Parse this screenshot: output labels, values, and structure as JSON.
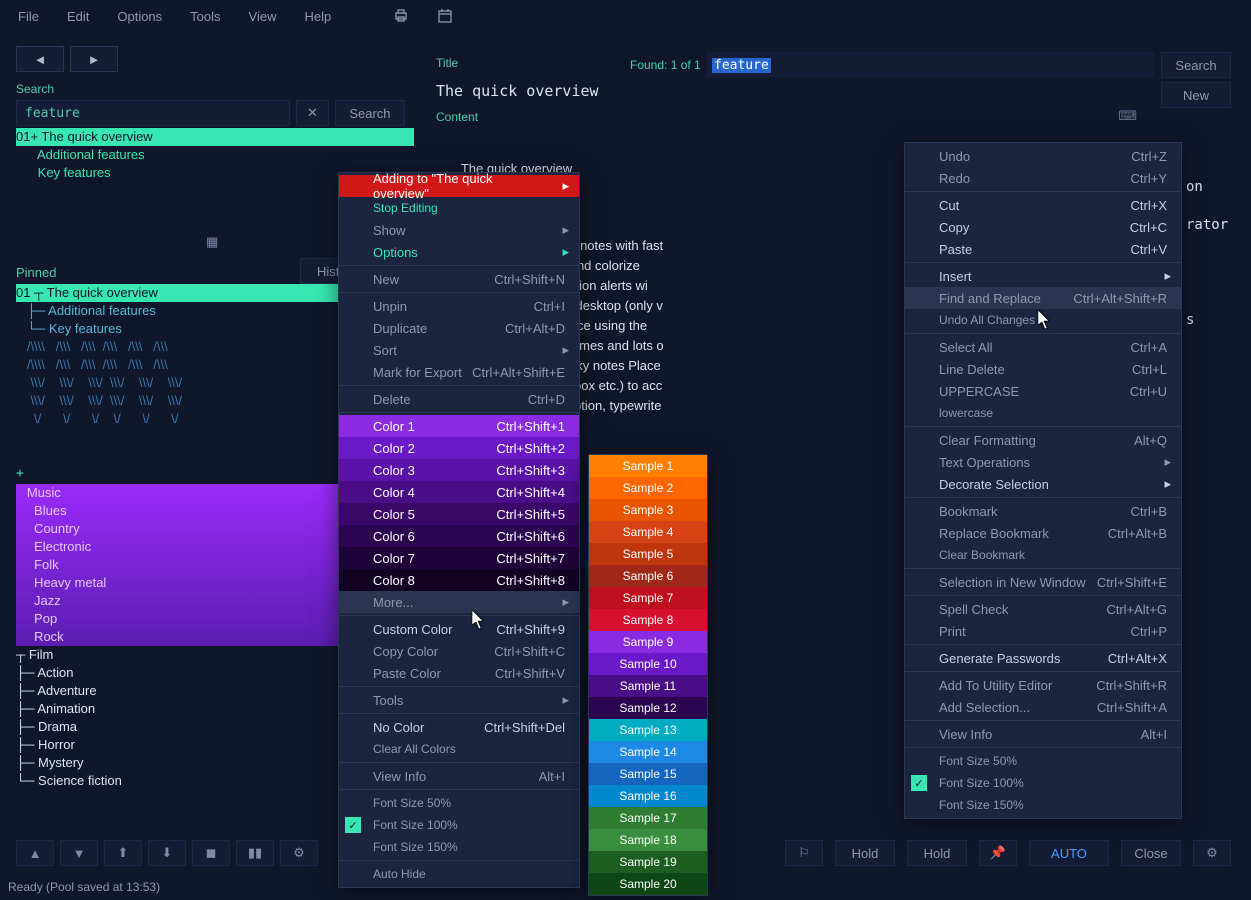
{
  "menu": {
    "file": "File",
    "edit": "Edit",
    "options": "Options",
    "tools": "Tools",
    "view": "View",
    "help": "Help"
  },
  "search": {
    "label": "Search",
    "value": "feature",
    "btn": "Search",
    "clear": "✕"
  },
  "tree": {
    "r1": "01+ The quick overview",
    "r2": "      Additional features",
    "r3": "      Key features"
  },
  "pinned": {
    "label": "Pinned",
    "hist": "Hist",
    "r1": "01 ┬ The quick overview",
    "r2": "   ├─ Additional features",
    "r3": "   └─ Key features",
    "a1": "   /\\\\\\\\   /\\\\\\   /\\\\\\  /\\\\\\   /\\\\\\   /\\\\\\",
    "a2": "   /\\\\\\\\   /\\\\\\   /\\\\\\  /\\\\\\   /\\\\\\   /\\\\\\",
    "a3": "    \\\\\\/    \\\\\\/    \\\\\\/  \\\\\\/    \\\\\\/    \\\\\\/",
    "a4": "    \\\\\\/    \\\\\\/    \\\\\\/  \\\\\\/    \\\\\\/    \\\\\\/",
    "a5": "     \\/      \\/      \\/    \\/      \\/      \\/",
    "plus": "+"
  },
  "music": {
    "r1": "   Music",
    "r2": "     Blues",
    "r3": "     Country",
    "r4": "     Electronic",
    "r5": "     Folk",
    "r6": "     Heavy metal",
    "r7": "     Jazz",
    "r8": "     Pop",
    "r9": "     Rock"
  },
  "film": {
    "r1": "┬ Film",
    "r2": "├─ Action",
    "r3": "├─ Adventure",
    "r4": "├─ Animation",
    "r5": "├─ Drama",
    "r6": "├─ Horror",
    "r7": "├─ Mystery",
    "r8": "└─ Science fiction"
  },
  "title": {
    "label": "Title",
    "found": "Found: 1 of 1",
    "hl": "feature",
    "search": "Search",
    "new": "New",
    "text": "The quick overview"
  },
  "contentlbl": "Content",
  "content": {
    "l1": "The quick overview",
    "body_a": "…pository of private notes with fast\n…rioritize, categorize and colorize\n…kup ",
    "body_hl": "feature",
    "body_b": "s Notification alerts wi\n…sticky notes on your desktop (only v\n…multiple entries at once using the\n…rogress bar Color themes and lots o\n…main editors and sticky notes Place\n…der (OneDrive, Dropbox etc.) to acc\n…ator, message encryption, typewrite",
    "tail": "on\n\nrator\n\n\n\n\ns"
  },
  "ctx1": {
    "adding": "Adding to \"The quick overview\"",
    "stop": "Stop Editing",
    "show": "Show",
    "options": "Options",
    "new": "New",
    "new_sc": "Ctrl+Shift+N",
    "unpin": "Unpin",
    "unpin_sc": "Ctrl+I",
    "dup": "Duplicate",
    "dup_sc": "Ctrl+Alt+D",
    "sort": "Sort",
    "mark": "Mark for Export",
    "mark_sc": "Ctrl+Alt+Shift+E",
    "del": "Delete",
    "del_sc": "Ctrl+D",
    "c1": "Color 1",
    "c1s": "Ctrl+Shift+1",
    "c2": "Color 2",
    "c2s": "Ctrl+Shift+2",
    "c3": "Color 3",
    "c3s": "Ctrl+Shift+3",
    "c4": "Color 4",
    "c4s": "Ctrl+Shift+4",
    "c5": "Color 5",
    "c5s": "Ctrl+Shift+5",
    "c6": "Color 6",
    "c6s": "Ctrl+Shift+6",
    "c7": "Color 7",
    "c7s": "Ctrl+Shift+7",
    "c8": "Color 8",
    "c8s": "Ctrl+Shift+8",
    "more": "More...",
    "custom": "Custom Color",
    "custom_sc": "Ctrl+Shift+9",
    "copyc": "Copy Color",
    "copyc_sc": "Ctrl+Shift+C",
    "pastec": "Paste Color",
    "pastec_sc": "Ctrl+Shift+V",
    "tools": "Tools",
    "noc": "No Color",
    "noc_sc": "Ctrl+Shift+Del",
    "clearc": "Clear All Colors",
    "vinfo": "View Info",
    "vinfo_sc": "Alt+I",
    "fs50": "Font Size 50%",
    "fs100": "Font Size 100%",
    "fs150": "Font Size 150%",
    "auto": "Auto Hide"
  },
  "colorcols": {
    "1": "#8a2be2",
    "2": "#6a19c8",
    "3": "#5a12a8",
    "4": "#4a0d88",
    "5": "#3a0868",
    "6": "#2c0550",
    "7": "#1e0338",
    "8": "#120224"
  },
  "samples": {
    "s1": {
      "l": "Sample 1",
      "c": "#ff7f00"
    },
    "s2": {
      "l": "Sample 2",
      "c": "#ff6600"
    },
    "s3": {
      "l": "Sample 3",
      "c": "#e85500"
    },
    "s4": {
      "l": "Sample 4",
      "c": "#d84315"
    },
    "s5": {
      "l": "Sample 5",
      "c": "#bf360c"
    },
    "s6": {
      "l": "Sample 6",
      "c": "#a02818"
    },
    "s7": {
      "l": "Sample 7",
      "c": "#c01020"
    },
    "s8": {
      "l": "Sample 8",
      "c": "#d81030"
    },
    "s9": {
      "l": "Sample 9",
      "c": "#8a2be2"
    },
    "s10": {
      "l": "Sample 10",
      "c": "#6a19c8"
    },
    "s11": {
      "l": "Sample 11",
      "c": "#4a0d88"
    },
    "s12": {
      "l": "Sample 12",
      "c": "#2c0550"
    },
    "s13": {
      "l": "Sample 13",
      "c": "#00acc1"
    },
    "s14": {
      "l": "Sample 14",
      "c": "#1e88e5"
    },
    "s15": {
      "l": "Sample 15",
      "c": "#1565c0"
    },
    "s16": {
      "l": "Sample 16",
      "c": "#0288d1"
    },
    "s17": {
      "l": "Sample 17",
      "c": "#2e7d32"
    },
    "s18": {
      "l": "Sample 18",
      "c": "#388e3c"
    },
    "s19": {
      "l": "Sample 19",
      "c": "#1b5e20"
    },
    "s20": {
      "l": "Sample 20",
      "c": "#0d4715"
    }
  },
  "ctx2": {
    "undo": "Undo",
    "undo_sc": "Ctrl+Z",
    "redo": "Redo",
    "redo_sc": "Ctrl+Y",
    "cut": "Cut",
    "cut_sc": "Ctrl+X",
    "copy": "Copy",
    "copy_sc": "Ctrl+C",
    "paste": "Paste",
    "paste_sc": "Ctrl+V",
    "insert": "Insert",
    "find": "Find and Replace",
    "find_sc": "Ctrl+Alt+Shift+R",
    "undoall": "Undo All Changes",
    "selall": "Select All",
    "selall_sc": "Ctrl+A",
    "ldel": "Line Delete",
    "ldel_sc": "Ctrl+L",
    "upper": "UPPERCASE",
    "upper_sc": "Ctrl+U",
    "lower": "lowercase",
    "clrfmt": "Clear Formatting",
    "clrfmt_sc": "Alt+Q",
    "txtop": "Text Operations",
    "deco": "Decorate Selection",
    "bkm": "Bookmark",
    "bkm_sc": "Ctrl+B",
    "repbkm": "Replace Bookmark",
    "repbkm_sc": "Ctrl+Alt+B",
    "clrbkm": "Clear Bookmark",
    "selwin": "Selection in New Window",
    "selwin_sc": "Ctrl+Shift+E",
    "spell": "Spell Check",
    "spell_sc": "Ctrl+Alt+G",
    "print": "Print",
    "print_sc": "Ctrl+P",
    "gen": "Generate Passwords",
    "gen_sc": "Ctrl+Alt+X",
    "addu": "Add To Utility Editor",
    "addu_sc": "Ctrl+Shift+R",
    "adds": "Add Selection...",
    "adds_sc": "Ctrl+Shift+A",
    "vinfo": "View Info",
    "vinfo_sc": "Alt+I",
    "fs50": "Font Size 50%",
    "fs100": "Font Size 100%",
    "fs150": "Font Size 150%"
  },
  "bb": {
    "hold1": "Hold",
    "hold2": "Hold",
    "auto": "AUTO",
    "close": "Close"
  },
  "status": "Ready (Pool saved at 13:53)"
}
